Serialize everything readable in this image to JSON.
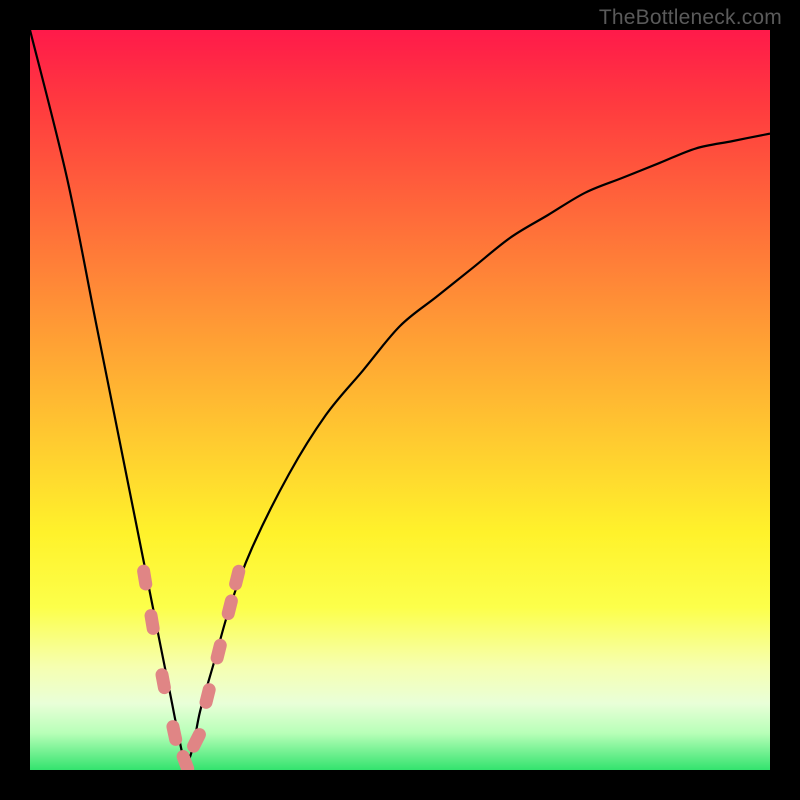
{
  "watermark": "TheBottleneck.com",
  "colors": {
    "frame": "#000000",
    "curve": "#000000",
    "marker": "#e08585",
    "gradient_top": "#ff1a4a",
    "gradient_bottom": "#33e36e"
  },
  "chart_data": {
    "type": "line",
    "title": "",
    "xlabel": "",
    "ylabel": "",
    "xlim": [
      0,
      100
    ],
    "ylim": [
      0,
      100
    ],
    "note": "V-shaped bottleneck curve; y is bottleneck % (0 best, 100 worst); minimum near x≈21",
    "series": [
      {
        "name": "bottleneck-curve",
        "x": [
          0,
          5,
          9,
          13,
          15,
          17,
          19,
          20,
          21,
          22,
          23,
          25,
          27,
          30,
          35,
          40,
          45,
          50,
          55,
          60,
          65,
          70,
          75,
          80,
          85,
          90,
          95,
          100
        ],
        "values": [
          100,
          80,
          60,
          40,
          30,
          20,
          10,
          5,
          1,
          3,
          8,
          15,
          22,
          30,
          40,
          48,
          54,
          60,
          64,
          68,
          72,
          75,
          78,
          80,
          82,
          84,
          85,
          86
        ]
      }
    ],
    "markers": {
      "name": "highlighted-segment",
      "shape": "rounded-dash",
      "color": "#e08585",
      "x": [
        15.5,
        16.5,
        18,
        19.5,
        21,
        22.5,
        24,
        25.5,
        27,
        28
      ],
      "values": [
        26,
        20,
        12,
        5,
        1,
        4,
        10,
        16,
        22,
        26
      ]
    }
  }
}
